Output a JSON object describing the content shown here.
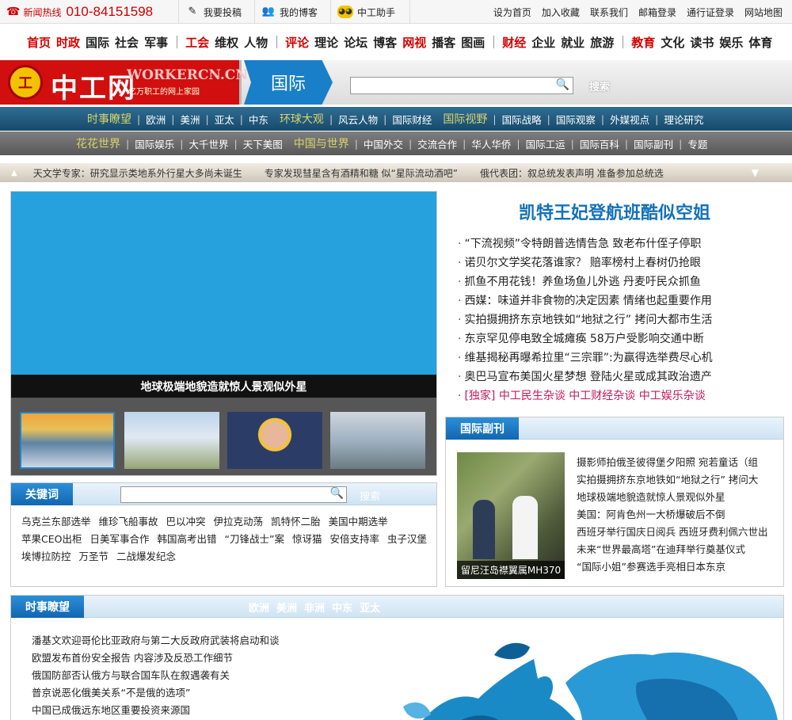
{
  "topbar": {
    "hotline_label": "新闻热线",
    "hotline_number": "010-84151598",
    "submit": "我要投稿",
    "blog": "我的博客",
    "helper": "中工助手",
    "links": [
      "设为首页",
      "加入收藏",
      "联系我们",
      "邮箱登录",
      "通行证登录",
      "网站地图"
    ]
  },
  "mainnav": {
    "groups": [
      [
        {
          "label": "首页",
          "red": true
        },
        {
          "label": "时政",
          "red": true
        },
        {
          "label": "国际"
        },
        {
          "label": "社会"
        },
        {
          "label": "军事"
        }
      ],
      [
        {
          "label": "工会",
          "red": true
        },
        {
          "label": "维权"
        },
        {
          "label": "人物"
        }
      ],
      [
        {
          "label": "评论",
          "red": true
        },
        {
          "label": "理论"
        },
        {
          "label": "论坛"
        },
        {
          "label": "博客"
        },
        {
          "label": "网视",
          "red": true
        },
        {
          "label": "播客"
        },
        {
          "label": "图画"
        }
      ],
      [
        {
          "label": "财经",
          "red": true
        },
        {
          "label": "企业"
        },
        {
          "label": "就业"
        },
        {
          "label": "旅游"
        }
      ],
      [
        {
          "label": "教育",
          "red": true
        },
        {
          "label": "文化"
        },
        {
          "label": "读书"
        },
        {
          "label": "娱乐"
        },
        {
          "label": "体育"
        }
      ]
    ]
  },
  "banner": {
    "logo_cn": "中工网",
    "logo_en": "WORKERCN.CN",
    "logo_slogan": "亿万职工的网上家园",
    "section": "国际",
    "search_btn": "搜索"
  },
  "subnav1": [
    "时事瞭望",
    "欧洲",
    "美洲",
    "亚太",
    "中东",
    "环球大观",
    "风云人物",
    "国际财经",
    "国际视野",
    "国际战略",
    "国际观察",
    "外媒视点",
    "理论研究"
  ],
  "subnav1_hl": [
    "时事瞭望",
    "环球大观",
    "国际视野"
  ],
  "subnav2": [
    "花花世界",
    "国际娱乐",
    "大千世界",
    "天下美图",
    "中国与世界",
    "中国外交",
    "交流合作",
    "华人华侨",
    "国际工运",
    "国际百科",
    "国际副刊",
    "专题"
  ],
  "subnav2_hl": [
    "花花世界",
    "中国与世界"
  ],
  "ticker": [
    "天文学专家：研究显示类地系外行星大多尚未诞生",
    "专家发现彗星含有酒精和糖 似“星际流动酒吧”",
    "俄代表团：叙总统发表声明 准备参加总统选"
  ],
  "focus": {
    "caption": "地球极端地貌造就惊人景观似外星"
  },
  "headline": "凯特王妃登航班酷似空姐",
  "news": [
    "“下流视频”令特朗普选情告急 致老布什侄子停职",
    "诺贝尔文学奖花落谁家？ 赔率榜村上春树仍抢眼",
    "抓鱼不用花钱！养鱼场鱼儿外逃 丹麦吁民众抓鱼",
    "西媒：味道并非食物的决定因素 情绪也起重要作用",
    "实拍摄拥挤东京地铁如“地狱之行” 拷问大都市生活",
    "东京罕见停电致全城瘫痪 58万户受影响交通中断",
    "维基揭秘再曝希拉里“三宗罪”:为赢得选举费尽心机",
    "奥巴马宣布美国火星梦想 登陆火星或成其政治遗产"
  ],
  "news_special": "[独家] 中工民生杂谈 中工财经杂谈 中工娱乐杂谈",
  "keywords": {
    "title": "关键词",
    "button": "搜索",
    "items": [
      "乌克兰东部选举",
      "维珍飞船事故",
      "巴以冲突",
      "伊拉克动荡",
      "凯特怀二胎",
      "美国中期选举",
      "苹果CEO出柜",
      "日美军事合作",
      "韩国高考出错",
      "“刀锋战士”案",
      "惊讶猫",
      "安倍支持率",
      "虫子汉堡",
      "埃博拉防控",
      "万圣节",
      "二战爆发纪念"
    ]
  },
  "fukan": {
    "title": "国际副刊",
    "pic_caption": "留尼汪岛襟翼属MH370",
    "items": [
      "摄影师拍俄圣彼得堡夕阳照 宛若童话（组",
      "实拍摄拥挤东京地铁如“地狱之行” 拷问大",
      "地球极端地貌造就惊人景观似外星",
      "美国：阿肯色州一大桥爆破后不倒",
      "西班牙举行国庆日阅兵 西班牙费利佩六世出",
      "未来“世界最高塔”在迪拜举行奠基仪式",
      "“国际小姐”参赛选手亮相日本东京"
    ]
  },
  "shishi": {
    "title": "时事瞭望",
    "regions": [
      "欧洲",
      "美洲",
      "非洲",
      "中东",
      "亚太"
    ],
    "items": [
      "潘基文欢迎哥伦比亚政府与第二大反政府武装将启动和谈",
      "欧盟发布首份安全报告 内容涉及反恐工作细节",
      "俄国防部否认俄方与联合国车队在叙遇袭有关",
      "普京说恶化俄美关系“不是俄的选项”",
      "中国已成俄远东地区重要投资来源国"
    ]
  },
  "colors": {
    "brand_red": "#d10f0f",
    "accent_blue": "#1571b8"
  }
}
